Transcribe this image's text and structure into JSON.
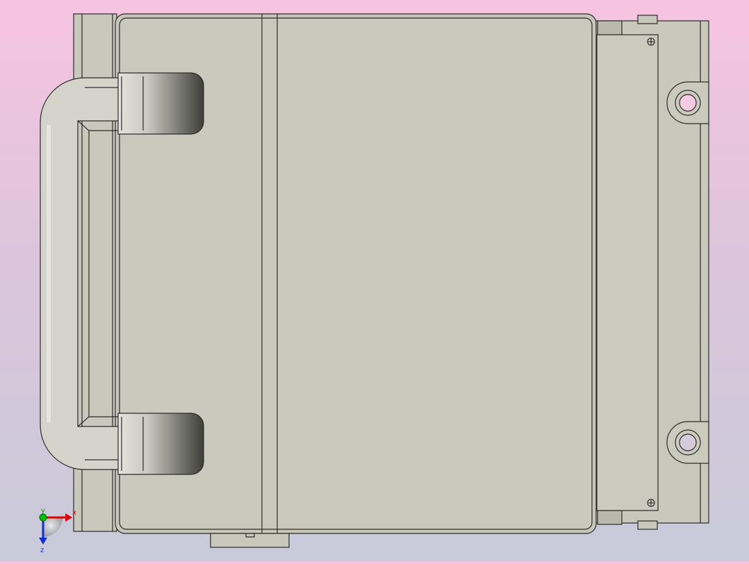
{
  "viewport": {
    "background_top": "#f7c4e0",
    "background_bottom": "#c9cbda",
    "model": {
      "face_color": "#c9c9be",
      "edge_color": "#2a2a2a",
      "handle_color": "#9e9e94"
    }
  },
  "triad": {
    "x_label": "x",
    "y_label": "y",
    "z_label": "z",
    "x_color": "#e00000",
    "y_color": "#00b000",
    "z_color": "#1030d0"
  }
}
